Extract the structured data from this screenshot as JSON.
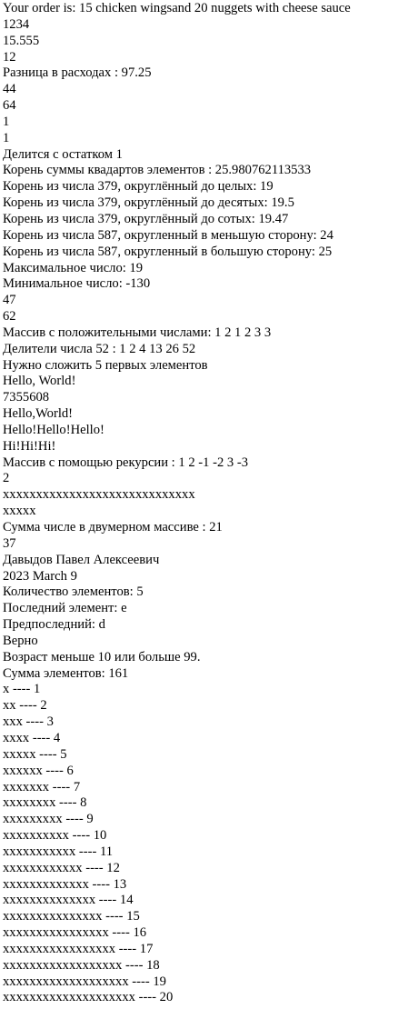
{
  "lines": [
    "Your order is: 15 chicken wingsand 20 nuggets with cheese sauce",
    "1234",
    "15.555",
    "12",
    "Разница в расходах : 97.25",
    "44",
    "64",
    "1",
    "1",
    "Делится с остатком 1",
    "Корень суммы квадартов элементов : 25.980762113533",
    "Корень из числа 379, округлённый до целых: 19",
    "Корень из числа 379, округлённый до десятых: 19.5",
    "Корень из числа 379, округлённый до сотых: 19.47",
    "Корень из числа 587, округленный в меньшую сторону: 24",
    "Корень из числа 587, округленный в большую сторону: 25",
    "Максимальное число: 19",
    "Минимальное число: -130",
    "47",
    "62",
    "Массив с положительными числами: 1 2 1 2 3 3",
    "Делители числа 52 : 1 2 4 13 26 52",
    "Нужно сложить 5 первых элементов",
    "Hello, World!",
    "7355608",
    "Hello,World!",
    "Hello!Hello!Hello!",
    "Hi!Hi!Hi!",
    "Массив с помощью рекурсии : 1 2 -1 -2 3 -3",
    "2",
    "xxxxxxxxxxxxxxxxxxxxxxxxxxxxx",
    "xxxxx",
    "Сумма числе в двумерном массиве : 21",
    "37",
    "Давыдов Павел Алексеевич",
    "2023 March 9",
    "Количество элементов: 5",
    "Последний элемент: e",
    "Предпоследний: d",
    "Верно",
    "Возраст меньше 10 или больше 99.",
    "Сумма элементов: 161",
    "x ---- 1",
    "xx ---- 2",
    "xxx ---- 3",
    "xxxx ---- 4",
    "xxxxx ---- 5",
    "xxxxxx ---- 6",
    "xxxxxxx ---- 7",
    "xxxxxxxx ---- 8",
    "xxxxxxxxx ---- 9",
    "xxxxxxxxxx ---- 10",
    "xxxxxxxxxxx ---- 11",
    "xxxxxxxxxxxx ---- 12",
    "xxxxxxxxxxxxx ---- 13",
    "xxxxxxxxxxxxxx ---- 14",
    "xxxxxxxxxxxxxxx ---- 15",
    "xxxxxxxxxxxxxxxx ---- 16",
    "xxxxxxxxxxxxxxxxx ---- 17",
    "xxxxxxxxxxxxxxxxxx ---- 18",
    "xxxxxxxxxxxxxxxxxxx ---- 19",
    "xxxxxxxxxxxxxxxxxxxx ---- 20"
  ]
}
